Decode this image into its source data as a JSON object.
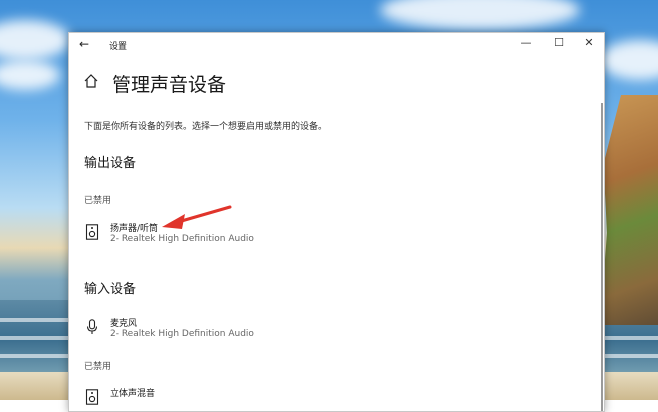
{
  "window": {
    "title": "设置",
    "back_glyph": "←",
    "min_glyph": "—",
    "max_glyph": "☐",
    "close_glyph": "✕"
  },
  "page": {
    "title": "管理声音设备",
    "description": "下面是你所有设备的列表。选择一个想要启用或禁用的设备。"
  },
  "output_section": {
    "title": "输出设备",
    "disabled_label": "已禁用",
    "devices": [
      {
        "name": "扬声器/听筒",
        "detail": "2- Realtek High Definition Audio",
        "icon": "speaker-icon"
      }
    ]
  },
  "input_section": {
    "title": "输入设备",
    "devices": [
      {
        "name": "麦克风",
        "detail": "2- Realtek High Definition Audio",
        "icon": "microphone-icon"
      }
    ],
    "disabled_label": "已禁用",
    "disabled_devices": [
      {
        "name": "立体声混音",
        "icon": "speaker-icon"
      }
    ]
  },
  "colors": {
    "annotation_arrow": "#e0342b",
    "window_bg": "#ffffff",
    "text_primary": "#1a1a1a",
    "text_secondary": "#666666"
  }
}
